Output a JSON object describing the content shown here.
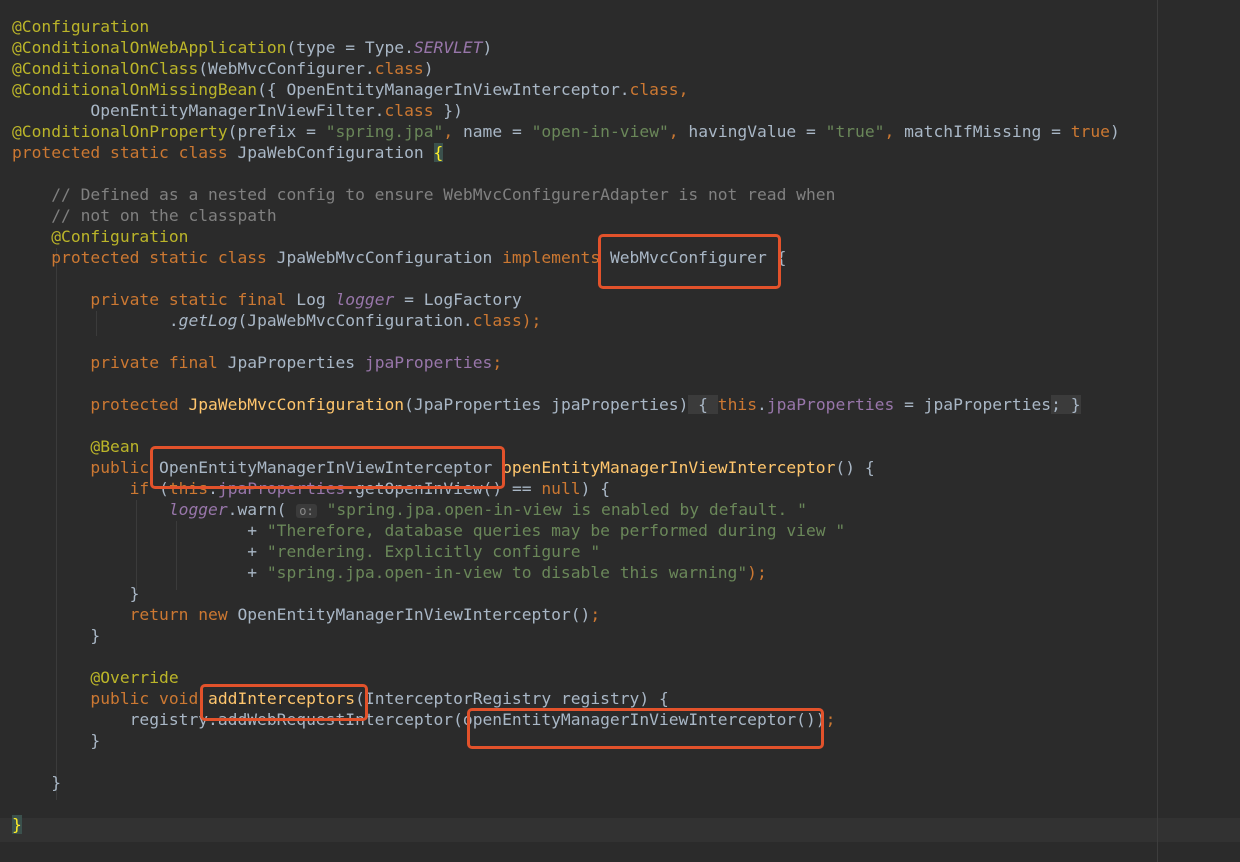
{
  "code_lines": [
    [
      {
        "t": "@Configuration",
        "c": "ann"
      }
    ],
    [
      {
        "t": "@ConditionalOnWebApplication",
        "c": "ann"
      },
      {
        "t": "(type = Type."
      },
      {
        "t": "SERVLET",
        "c": "ifield"
      },
      {
        "t": ")"
      }
    ],
    [
      {
        "t": "@ConditionalOnClass",
        "c": "ann"
      },
      {
        "t": "(WebMvcConfigurer."
      },
      {
        "t": "class",
        "c": "kw"
      },
      {
        "t": ")"
      }
    ],
    [
      {
        "t": "@ConditionalOnMissingBean",
        "c": "ann"
      },
      {
        "t": "({ OpenEntityManagerInViewInterceptor."
      },
      {
        "t": "class",
        "c": "kw"
      },
      {
        "t": ",",
        "c": "kw"
      }
    ],
    [
      {
        "t": "        OpenEntityManagerInViewFilter."
      },
      {
        "t": "class",
        "c": "kw"
      },
      {
        "t": " })"
      }
    ],
    [
      {
        "t": "@ConditionalOnProperty",
        "c": "ann"
      },
      {
        "t": "(prefix = "
      },
      {
        "t": "\"spring.jpa\"",
        "c": "str"
      },
      {
        "t": ", ",
        "c": "kw"
      },
      {
        "t": "name = "
      },
      {
        "t": "\"open-in-view\"",
        "c": "str"
      },
      {
        "t": ", ",
        "c": "kw"
      },
      {
        "t": "havingValue = "
      },
      {
        "t": "\"true\"",
        "c": "str"
      },
      {
        "t": ", ",
        "c": "kw"
      },
      {
        "t": "matchIfMissing = "
      },
      {
        "t": "true",
        "c": "kw"
      },
      {
        "t": ")"
      }
    ],
    [
      {
        "t": "protected static class ",
        "c": "kw"
      },
      {
        "t": "JpaWebConfiguration "
      },
      {
        "t": "{",
        "c": "brace"
      }
    ],
    [],
    [
      {
        "t": "    // Defined as a nested config to ensure WebMvcConfigurerAdapter is not read when",
        "c": "comment"
      }
    ],
    [
      {
        "t": "    // not on the classpath",
        "c": "comment"
      }
    ],
    [
      {
        "t": "    @Configuration",
        "c": "ann"
      }
    ],
    [
      {
        "t": "    protected static class ",
        "c": "kw"
      },
      {
        "t": "JpaWebMvcConfiguration "
      },
      {
        "t": "implements ",
        "c": "kw"
      },
      {
        "t": "WebMvcConfigurer {"
      }
    ],
    [],
    [
      {
        "t": "        private static final ",
        "c": "kw"
      },
      {
        "t": "Log "
      },
      {
        "t": "logger",
        "c": "ifield"
      },
      {
        "t": " = LogFactory"
      }
    ],
    [
      {
        "t": "                ."
      },
      {
        "t": "getLog",
        "c": "italic"
      },
      {
        "t": "(JpaWebMvcConfiguration."
      },
      {
        "t": "class",
        "c": "kw"
      },
      {
        "t": ");",
        "c": "kw"
      }
    ],
    [],
    [
      {
        "t": "        private final ",
        "c": "kw"
      },
      {
        "t": "JpaProperties "
      },
      {
        "t": "jpaProperties",
        "c": "field"
      },
      {
        "t": ";",
        "c": "kw"
      }
    ],
    [],
    [
      {
        "t": "        protected ",
        "c": "kw"
      },
      {
        "t": "JpaWebMvcConfiguration",
        "c": "method"
      },
      {
        "t": "(JpaProperties jpaProperties)"
      },
      {
        "t": " { ",
        "c": "fold"
      },
      {
        "t": "this",
        "c": "kw"
      },
      {
        "t": "."
      },
      {
        "t": "jpaProperties",
        "c": "field"
      },
      {
        "t": " = jpaProperties"
      },
      {
        "t": "; }",
        "c": "fold"
      }
    ],
    [],
    [
      {
        "t": "        @Bean",
        "c": "ann"
      }
    ],
    [
      {
        "t": "        public ",
        "c": "kw"
      },
      {
        "t": "OpenEntityManagerInViewInterceptor "
      },
      {
        "t": "openEntityManagerInViewInterceptor",
        "c": "method"
      },
      {
        "t": "() {"
      }
    ],
    [
      {
        "t": "            if ",
        "c": "kw"
      },
      {
        "t": "("
      },
      {
        "t": "this",
        "c": "kw"
      },
      {
        "t": "."
      },
      {
        "t": "jpaProperties",
        "c": "field"
      },
      {
        "t": ".getOpenInView() == "
      },
      {
        "t": "null",
        "c": "kw"
      },
      {
        "t": ") {"
      }
    ],
    [
      {
        "t": "                "
      },
      {
        "t": "logger",
        "c": "ifield"
      },
      {
        "t": ".warn( "
      },
      {
        "t": "o:",
        "c": "hint"
      },
      {
        "t": " "
      },
      {
        "t": "\"spring.jpa.open-in-view is enabled by default. \"",
        "c": "str"
      }
    ],
    [
      {
        "t": "                        + "
      },
      {
        "t": "\"Therefore, database queries may be performed during view \"",
        "c": "str"
      }
    ],
    [
      {
        "t": "                        + "
      },
      {
        "t": "\"rendering. Explicitly configure \"",
        "c": "str"
      }
    ],
    [
      {
        "t": "                        + "
      },
      {
        "t": "\"spring.jpa.open-in-view to disable this warning\"",
        "c": "str"
      },
      {
        "t": ");",
        "c": "kw"
      }
    ],
    [
      {
        "t": "            }"
      }
    ],
    [
      {
        "t": "            return new ",
        "c": "kw"
      },
      {
        "t": "OpenEntityManagerInViewInterceptor()"
      },
      {
        "t": ";",
        "c": "kw"
      }
    ],
    [
      {
        "t": "        }"
      }
    ],
    [],
    [
      {
        "t": "        @Override",
        "c": "ann"
      }
    ],
    [
      {
        "t": "        public void ",
        "c": "kw"
      },
      {
        "t": "addInterceptors",
        "c": "method"
      },
      {
        "t": "(InterceptorRegistry registry) {"
      }
    ],
    [
      {
        "t": "            registry.addWebRequestInterceptor(openEntityManagerInViewInterceptor())"
      },
      {
        "t": ";",
        "c": "kw"
      }
    ],
    [
      {
        "t": "        }"
      }
    ],
    [],
    [
      {
        "t": "    }"
      }
    ],
    [],
    [
      {
        "t": "}",
        "c": "brace"
      }
    ]
  ],
  "highlights": [
    {
      "label": "WebMvcConfigurer"
    },
    {
      "label": "OpenEntityManagerInViewInterceptor"
    },
    {
      "label": "addInterceptors"
    },
    {
      "label": "openEntityManagerInViewInterceptor()"
    }
  ],
  "colors": {
    "background": "#2b2b2b",
    "annotation": "#bbb529",
    "keyword": "#cc7832",
    "string": "#6a8759",
    "field": "#9876aa",
    "method": "#ffc66d",
    "comment": "#808080",
    "text": "#a9b7c6",
    "highlight_box": "#e2522b"
  }
}
